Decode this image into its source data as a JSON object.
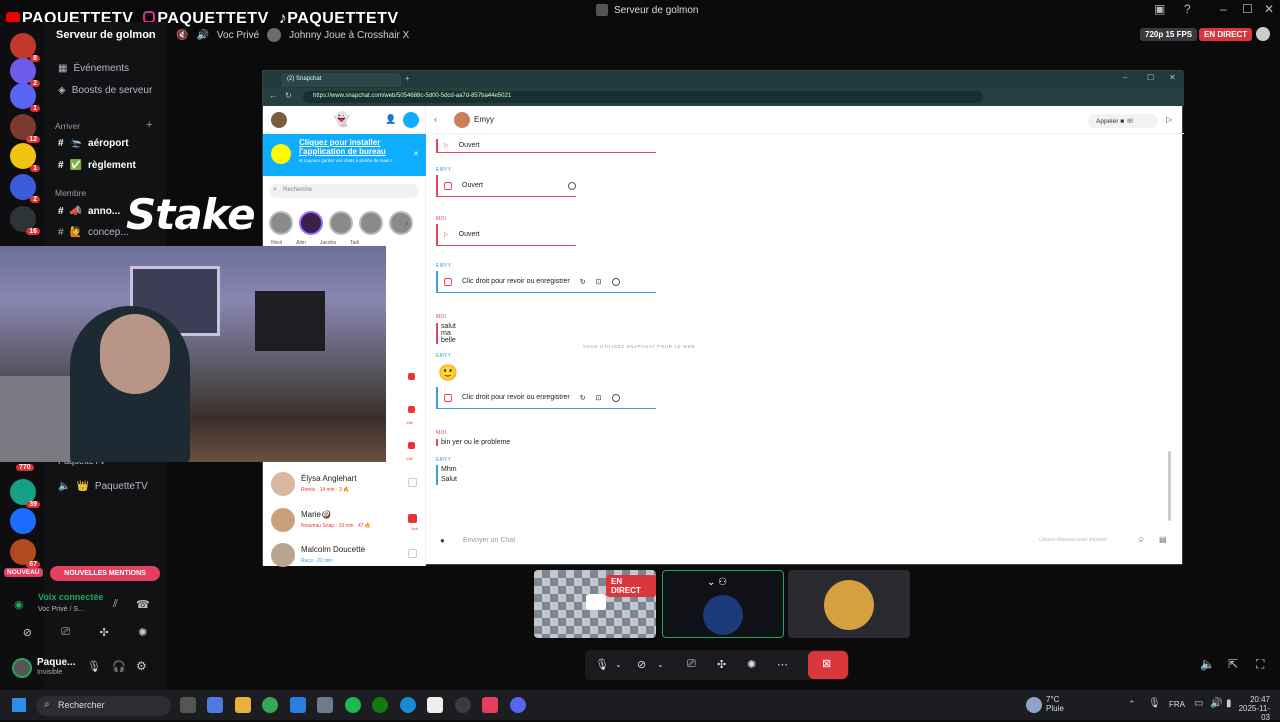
{
  "window": {
    "title": "Serveur de golmon",
    "brand_yt": "PAQUETTETV",
    "brand_ig": "PAQUETTETV",
    "brand_tt": "PAQUETTETV"
  },
  "discord": {
    "server_name": "Serveur de golmon",
    "voice_channel": "Voc Privé",
    "activity": "Johnny Joue à Crosshair X",
    "stream_quality": "720p 15 FPS",
    "live_badge": "EN DIRECT",
    "events_label": "Événements",
    "boosts_label": "Boosts de serveur",
    "category_arriver": "Arriver",
    "channels": [
      {
        "name": "aéroport",
        "emoji": "🛬"
      },
      {
        "name": "règlement",
        "emoji": "✅"
      }
    ],
    "category_membre": "Membre",
    "member_channels": [
      {
        "name": "anno...",
        "emoji": "📣"
      },
      {
        "name": "concep...",
        "emoji": "🙋"
      }
    ],
    "voice_user_partial": "PaquetteTV",
    "voice_user": "PaquetteTV",
    "new_label": "NOUVEAU",
    "new_mentions": "NOUVELLES MENTIONS",
    "voice_connected": "Voix connectée",
    "voice_connected_sub": "Voc Privé / S...",
    "user_name": "Paque...",
    "user_status": "Invisible",
    "server_badges": [
      "8",
      "2",
      "1",
      "12",
      "1",
      "2",
      "16",
      "770",
      "39",
      "67"
    ],
    "live_tile_badge": "EN DIRECT"
  },
  "stake_logo": "Stake",
  "browser": {
    "tab_title": "(2) Snapchat",
    "url": "https://www.snapchat.com/web/5054688c-5d00-5dcd-aa7d-857ba44e5021"
  },
  "snapchat": {
    "banner_title": "Cliquez pour installer l'application de bureau",
    "banner_sub": "et toujours garder vos chats à portée de main !",
    "search_placeholder": "Recherche",
    "story_names": [
      "Nicol",
      "",
      "Alim",
      "Jacoba",
      "Tadi"
    ],
    "friends": [
      {
        "name": "Élysa Anglehart",
        "sub": "Remis · 14 min · 3 🔥",
        "tone": "red"
      },
      {
        "name": "Marie🥥",
        "sub": "Nouveau Snap · 19 min · 47 🔥",
        "tone": "red",
        "tag": "Voir"
      },
      {
        "name": "Malcolm Doucette",
        "sub": "Reçu · 22 min",
        "tone": "blue"
      }
    ],
    "voir_label": "Voir",
    "chat_name": "Emyy",
    "call_label": "Appeler",
    "labels": {
      "me": "MOI",
      "her": "EMYY"
    },
    "messages": {
      "opened": "Ouvert",
      "replay": "Clic droit pour revoir ou enregistrer",
      "text1": "salut ma belle",
      "text2": "bin yer ou le probleme",
      "text3": "Mhm",
      "text4": "Salut",
      "emoji": "🙂"
    },
    "web_notice": "VOUS UTILISEZ SNAPCHAT POUR LE WEB",
    "send_placeholder": "Envoyer un Chat",
    "send_hint": "Glissez-déposez pour importer"
  },
  "taskbar": {
    "search": "Rechercher",
    "weather_temp": "7°C",
    "weather_desc": "Pluie",
    "lang": "FRA",
    "time": "20:47",
    "date": "2025-11-03"
  }
}
